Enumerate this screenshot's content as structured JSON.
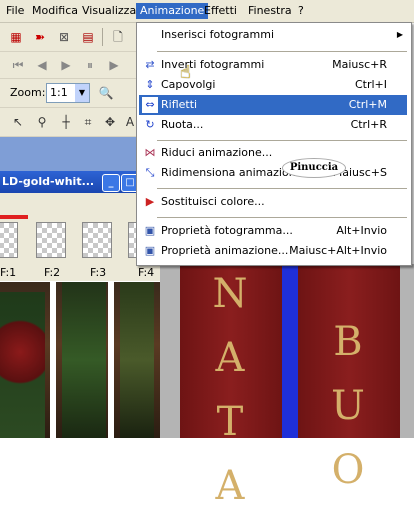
{
  "menubar": {
    "items": [
      "File",
      "Modifica",
      "Visualizza",
      "Animazione",
      "Effetti",
      "Finestra",
      "?"
    ],
    "active": "Animazione"
  },
  "toolbar": {
    "zoom_label": "Zoom:",
    "zoom_value": "1:1"
  },
  "document": {
    "title": "LD-gold-whit..."
  },
  "frames": [
    "F:1",
    "F:2",
    "F:3",
    "F:4"
  ],
  "menu": {
    "items": [
      {
        "label": "Inserisci fotogrammi",
        "shortcut": "",
        "submenu": true
      },
      {
        "label": "Inverti fotogrammi",
        "shortcut": "Maiusc+R"
      },
      {
        "label": "Capovolgi",
        "shortcut": "Ctrl+I"
      },
      {
        "label": "Rifletti",
        "shortcut": "Ctrl+M"
      },
      {
        "label": "Ruota...",
        "shortcut": "Ctrl+R"
      },
      {
        "label": "Riduci animazione...",
        "shortcut": ""
      },
      {
        "label": "Ridimensiona animazione...",
        "shortcut": "Maiusc+S"
      },
      {
        "label": "Sostituisci colore...",
        "shortcut": ""
      },
      {
        "label": "Proprietà fotogramma...",
        "shortcut": "Alt+Invio"
      },
      {
        "label": "Proprietà animazione...",
        "shortcut": "Maiusc+Alt+Invio"
      }
    ]
  },
  "watermark": "Pinuccia",
  "canvas": {
    "letters_left": [
      "N",
      "A",
      "T",
      "A"
    ],
    "letters_right": [
      "B",
      "U",
      "O"
    ]
  },
  "colors": {
    "menu_highlight": "#316ac5",
    "panel_red": "#8a1e1e",
    "panel_blue": "#1f2fd8",
    "gold": "#d4b06a"
  }
}
